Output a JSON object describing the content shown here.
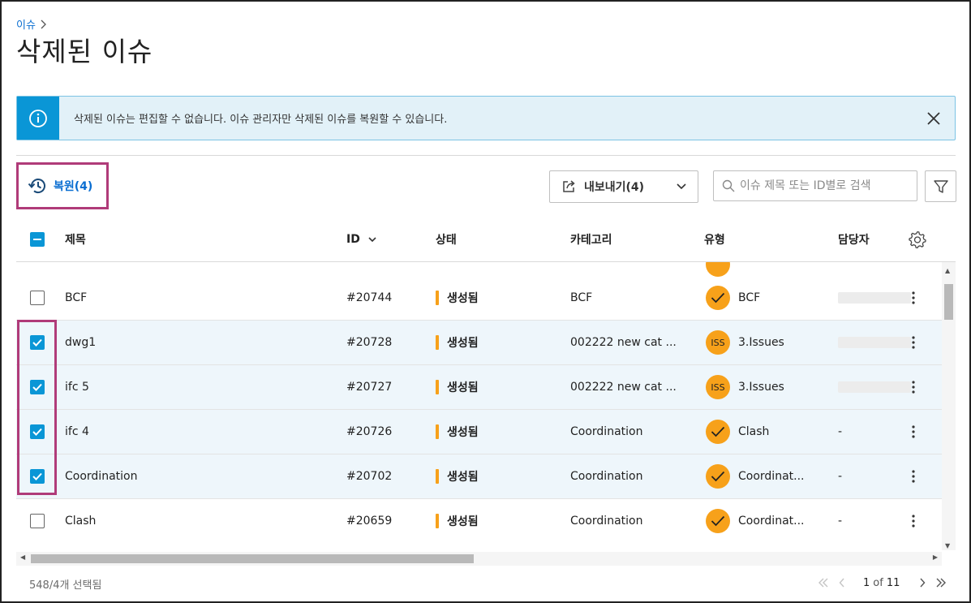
{
  "breadcrumb": {
    "item": "이슈"
  },
  "page": {
    "title": "삭제된 이슈"
  },
  "banner": {
    "message": "삭제된 이슈는 편집할 수 없습니다. 이슈 관리자만 삭제된 이슈를 복원할 수 있습니다."
  },
  "toolbar": {
    "restore_label": "복원(4)",
    "export_label": "내보내기(4)",
    "search_placeholder": "이슈 제목 또는 ID별로 검색"
  },
  "table": {
    "columns": {
      "title": "제목",
      "id": "ID",
      "status": "상태",
      "category": "카테고리",
      "type": "유형",
      "assignee": "담당자"
    },
    "rows": [
      {
        "title": "BCF",
        "id": "#20744",
        "status": "생성됨",
        "category": "BCF",
        "type_icon": "check",
        "type": "BCF",
        "assignee": "",
        "selected": false
      },
      {
        "title": "dwg1",
        "id": "#20728",
        "status": "생성됨",
        "category": "002222 new cat ...",
        "type_icon": "ISS",
        "type": "3.Issues",
        "assignee": "",
        "selected": true
      },
      {
        "title": "ifc 5",
        "id": "#20727",
        "status": "생성됨",
        "category": "002222 new cat ...",
        "type_icon": "ISS",
        "type": "3.Issues",
        "assignee": "",
        "selected": true
      },
      {
        "title": "ifc 4",
        "id": "#20726",
        "status": "생성됨",
        "category": "Coordination",
        "type_icon": "check",
        "type": "Clash",
        "assignee": "-",
        "selected": true
      },
      {
        "title": "Coordination",
        "id": "#20702",
        "status": "생성됨",
        "category": "Coordination",
        "type_icon": "check",
        "type": "Coordinat...",
        "assignee": "-",
        "selected": true
      },
      {
        "title": "Clash",
        "id": "#20659",
        "status": "생성됨",
        "category": "Coordination",
        "type_icon": "check",
        "type": "Coordinat...",
        "assignee": "-",
        "selected": false
      }
    ]
  },
  "footer": {
    "selection": "548/4개 선택됨",
    "page_current": "1",
    "page_of": "of",
    "page_total": "11"
  },
  "colors": {
    "accent": "#0a96d6",
    "highlight": "#b03b79",
    "status": "#f7a11a"
  }
}
